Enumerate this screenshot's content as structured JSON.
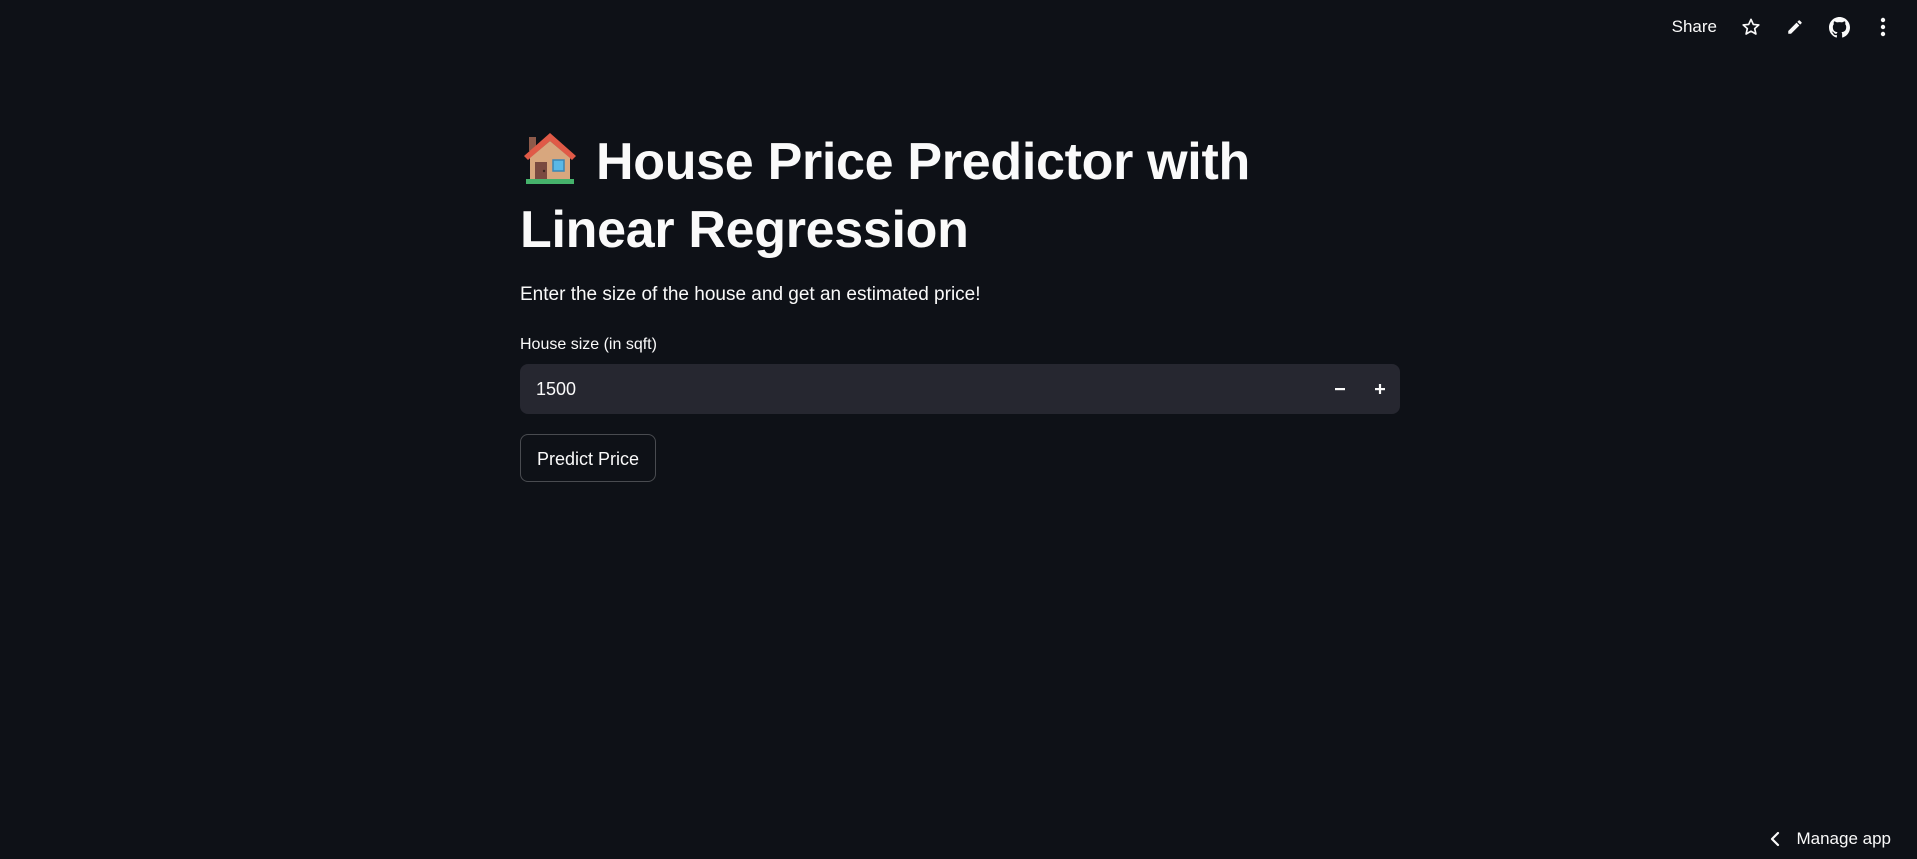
{
  "toolbar": {
    "share_label": "Share",
    "icons": [
      "star-icon",
      "pencil-icon",
      "github-icon",
      "more-vertical-icon"
    ]
  },
  "main": {
    "title": "House Price Predictor with Linear Regression",
    "title_icon": "house-icon",
    "subtitle": "Enter the size of the house and get an estimated price!",
    "input": {
      "label": "House size (in sqft)",
      "value": "1500"
    },
    "predict_button_label": "Predict Price"
  },
  "footer": {
    "manage_label": "Manage app"
  },
  "colors": {
    "background": "#0e1117",
    "input_background": "#262730",
    "text": "#fafafa"
  }
}
